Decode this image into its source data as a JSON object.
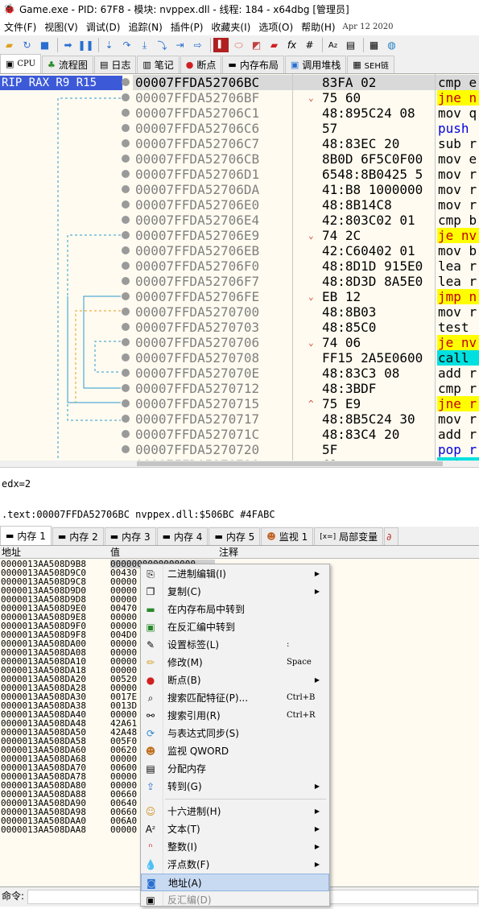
{
  "window": {
    "title": "Game.exe - PID: 67F8 - 模块: nvppex.dll - 线程: 184 - x64dbg [管理员]"
  },
  "menu": {
    "items": [
      "文件(F)",
      "视图(V)",
      "调试(D)",
      "追踪(N)",
      "插件(P)",
      "收藏夹(I)",
      "选项(O)",
      "帮助(H)"
    ],
    "date": "Apr 12 2020"
  },
  "toolbar": {
    "icons": [
      "open-icon",
      "restart-icon",
      "stop-icon",
      "run-icon",
      "pause-icon",
      "step-into-icon",
      "step-over-icon",
      "trace-into-icon",
      "trace-over-icon",
      "execute-till-return-icon",
      "run-to-user-icon",
      "patch-icon",
      "comment-icon",
      "label-icon",
      "bookmark-icon",
      "function-icon",
      "hash-icon",
      "font-icon",
      "strings-icon",
      "calculator-icon",
      "help-icon"
    ]
  },
  "main_tabs": [
    "CPU",
    "流程图",
    "日志",
    "笔记",
    "断点",
    "内存布局",
    "调用堆栈",
    "SEH链"
  ],
  "cpu": {
    "regs": "RIP RAX R9 R15",
    "rows": [
      {
        "addr": "00007FFDA52706BC",
        "arrow": "",
        "bytes": "83FA 02",
        "ins": "cmp e",
        "style": ""
      },
      {
        "addr": "00007FFDA52706BF",
        "arrow": "⌄",
        "bytes": "75 60",
        "ins": "jne n",
        "style": "y"
      },
      {
        "addr": "00007FFDA52706C1",
        "arrow": "",
        "bytes": "48:895C24 08",
        "ins": "mov q",
        "style": ""
      },
      {
        "addr": "00007FFDA52706C6",
        "arrow": "",
        "bytes": "57",
        "ins": "push",
        "style": "b"
      },
      {
        "addr": "00007FFDA52706C7",
        "arrow": "",
        "bytes": "48:83EC 20",
        "ins": "sub r",
        "style": ""
      },
      {
        "addr": "00007FFDA52706CB",
        "arrow": "",
        "bytes": "8B0D 6F5C0F00",
        "ins": "mov e",
        "style": ""
      },
      {
        "addr": "00007FFDA52706D1",
        "arrow": "",
        "bytes": "6548:8B0425 5",
        "ins": "mov r",
        "style": ""
      },
      {
        "addr": "00007FFDA52706DA",
        "arrow": "",
        "bytes": "41:B8 1000000",
        "ins": "mov r",
        "style": ""
      },
      {
        "addr": "00007FFDA52706E0",
        "arrow": "",
        "bytes": "48:8B14C8",
        "ins": "mov r",
        "style": ""
      },
      {
        "addr": "00007FFDA52706E4",
        "arrow": "",
        "bytes": "42:803C02 01",
        "ins": "cmp b",
        "style": ""
      },
      {
        "addr": "00007FFDA52706E9",
        "arrow": "⌄",
        "bytes": "74 2C",
        "ins": "je nv",
        "style": "y"
      },
      {
        "addr": "00007FFDA52706EB",
        "arrow": "",
        "bytes": "42:C60402 01",
        "ins": "mov b",
        "style": ""
      },
      {
        "addr": "00007FFDA52706F0",
        "arrow": "",
        "bytes": "48:8D1D 915E0",
        "ins": "lea r",
        "style": ""
      },
      {
        "addr": "00007FFDA52706F7",
        "arrow": "",
        "bytes": "48:8D3D 8A5E0",
        "ins": "lea r",
        "style": ""
      },
      {
        "addr": "00007FFDA52706FE",
        "arrow": "⌄",
        "bytes": "EB 12",
        "ins": "jmp n",
        "style": "y"
      },
      {
        "addr": "00007FFDA5270700",
        "arrow": "",
        "bytes": "48:8B03",
        "ins": "mov r",
        "style": ""
      },
      {
        "addr": "00007FFDA5270703",
        "arrow": "",
        "bytes": "48:85C0",
        "ins": "test",
        "style": ""
      },
      {
        "addr": "00007FFDA5270706",
        "arrow": "⌄",
        "bytes": "74 06",
        "ins": "je nv",
        "style": "y"
      },
      {
        "addr": "00007FFDA5270708",
        "arrow": "",
        "bytes": "FF15 2A5E0600",
        "ins": "call",
        "style": "c"
      },
      {
        "addr": "00007FFDA527070E",
        "arrow": "",
        "bytes": "48:83C3 08",
        "ins": "add r",
        "style": ""
      },
      {
        "addr": "00007FFDA5270712",
        "arrow": "",
        "bytes": "48:3BDF",
        "ins": "cmp r",
        "style": ""
      },
      {
        "addr": "00007FFDA5270715",
        "arrow": "^",
        "bytes": "75 E9",
        "ins": "jne r",
        "style": "y"
      },
      {
        "addr": "00007FFDA5270717",
        "arrow": "",
        "bytes": "48:8B5C24 30",
        "ins": "mov r",
        "style": ""
      },
      {
        "addr": "00007FFDA527071C",
        "arrow": "",
        "bytes": "48:83C4 20",
        "ins": "add r",
        "style": ""
      },
      {
        "addr": "00007FFDA5270720",
        "arrow": "",
        "bytes": "5F",
        "ins": "pop r",
        "style": "b"
      },
      {
        "addr": "00007FFDA5270721",
        "arrow": "",
        "bytes": "C3",
        "ins": "ret",
        "style": "c"
      }
    ]
  },
  "info": {
    "line1": "edx=2",
    "line2": ".text:00007FFDA52706BC nvppex.dll:$506BC #4FABC"
  },
  "dump_tabs": [
    "内存 1",
    "内存 2",
    "内存 3",
    "内存 4",
    "内存 5",
    "监视 1",
    "局部变量"
  ],
  "dump": {
    "headers": {
      "addr": "地址",
      "value": "值",
      "comment": "注释"
    },
    "rows": [
      {
        "a": "0000013AA508D9B8",
        "v": "0000000000000000"
      },
      {
        "a": "0000013AA508D9C0",
        "v": "00430"
      },
      {
        "a": "0000013AA508D9C8",
        "v": "00000"
      },
      {
        "a": "0000013AA508D9D0",
        "v": "00000"
      },
      {
        "a": "0000013AA508D9D8",
        "v": "00000"
      },
      {
        "a": "0000013AA508D9E0",
        "v": "00470"
      },
      {
        "a": "0000013AA508D9E8",
        "v": "00000"
      },
      {
        "a": "0000013AA508D9F0",
        "v": "00000"
      },
      {
        "a": "0000013AA508D9F8",
        "v": "004D0"
      },
      {
        "a": "0000013AA508DA00",
        "v": "00000"
      },
      {
        "a": "0000013AA508DA08",
        "v": "00000"
      },
      {
        "a": "0000013AA508DA10",
        "v": "00000"
      },
      {
        "a": "0000013AA508DA18",
        "v": "00000"
      },
      {
        "a": "0000013AA508DA20",
        "v": "00520"
      },
      {
        "a": "0000013AA508DA28",
        "v": "00000"
      },
      {
        "a": "0000013AA508DA30",
        "v": "0017E"
      },
      {
        "a": "0000013AA508DA38",
        "v": "0013D"
      },
      {
        "a": "0000013AA508DA40",
        "v": "00000"
      },
      {
        "a": "0000013AA508DA48",
        "v": "42A61"
      },
      {
        "a": "0000013AA508DA50",
        "v": "42A48"
      },
      {
        "a": "0000013AA508DA58",
        "v": "005F0"
      },
      {
        "a": "0000013AA508DA60",
        "v": "00620"
      },
      {
        "a": "0000013AA508DA68",
        "v": "00000"
      },
      {
        "a": "0000013AA508DA70",
        "v": "00600"
      },
      {
        "a": "0000013AA508DA78",
        "v": "00000"
      },
      {
        "a": "0000013AA508DA80",
        "v": "00000"
      },
      {
        "a": "0000013AA508DA88",
        "v": "00660"
      },
      {
        "a": "0000013AA508DA90",
        "v": "00640"
      },
      {
        "a": "0000013AA508DA98",
        "v": "00660"
      },
      {
        "a": "0000013AA508DAA0",
        "v": "006A0"
      },
      {
        "a": "0000013AA508DAA8",
        "v": "00000"
      }
    ]
  },
  "context_menu": [
    {
      "label": "二进制编辑(I)",
      "shortcut": "",
      "sub": true,
      "icon": "binary-edit-icon"
    },
    {
      "label": "复制(C)",
      "shortcut": "",
      "sub": true,
      "icon": "copy-icon"
    },
    {
      "label": "在内存布局中转到",
      "shortcut": "",
      "sub": false,
      "icon": "memory-map-icon"
    },
    {
      "label": "在反汇编中转到",
      "shortcut": "",
      "sub": false,
      "icon": "disassembly-icon"
    },
    {
      "label": "设置标签(L)",
      "shortcut": ":",
      "sub": false,
      "icon": "label-icon"
    },
    {
      "label": "修改(M)",
      "shortcut": "Space",
      "sub": false,
      "icon": "modify-icon"
    },
    {
      "label": "断点(B)",
      "shortcut": "",
      "sub": true,
      "icon": "breakpoint-icon"
    },
    {
      "label": "搜索匹配特征(P)...",
      "shortcut": "Ctrl+B",
      "sub": false,
      "icon": "search-pattern-icon"
    },
    {
      "label": "搜索引用(R)",
      "shortcut": "Ctrl+R",
      "sub": false,
      "icon": "binoculars-icon"
    },
    {
      "label": "与表达式同步(S)",
      "shortcut": "",
      "sub": false,
      "icon": "sync-icon"
    },
    {
      "label": "监视 QWORD",
      "shortcut": "",
      "sub": false,
      "icon": "watch-icon"
    },
    {
      "label": "分配内存",
      "shortcut": "",
      "sub": false,
      "icon": "allocate-memory-icon"
    },
    {
      "label": "转到(G)",
      "shortcut": "",
      "sub": true,
      "icon": "goto-icon"
    },
    {
      "label": "十六进制(H)",
      "shortcut": "",
      "sub": true,
      "icon": "hex-icon"
    },
    {
      "label": "文本(T)",
      "shortcut": "",
      "sub": true,
      "icon": "text-icon"
    },
    {
      "label": "整数(I)",
      "shortcut": "",
      "sub": true,
      "icon": "integer-icon"
    },
    {
      "label": "浮点数(F)",
      "shortcut": "",
      "sub": true,
      "icon": "float-icon"
    },
    {
      "label": "地址(A)",
      "shortcut": "",
      "sub": false,
      "icon": "address-icon"
    },
    {
      "label": "反汇编(D)",
      "shortcut": "",
      "sub": false,
      "icon": "disassemble-icon"
    }
  ],
  "command": {
    "label": "命令:"
  },
  "colors": {
    "selection_blue": "#3c5ad8",
    "jump_highlight": "#ffff00",
    "call_highlight": "#00e0e0",
    "menu_highlight": "#c8daf2"
  }
}
